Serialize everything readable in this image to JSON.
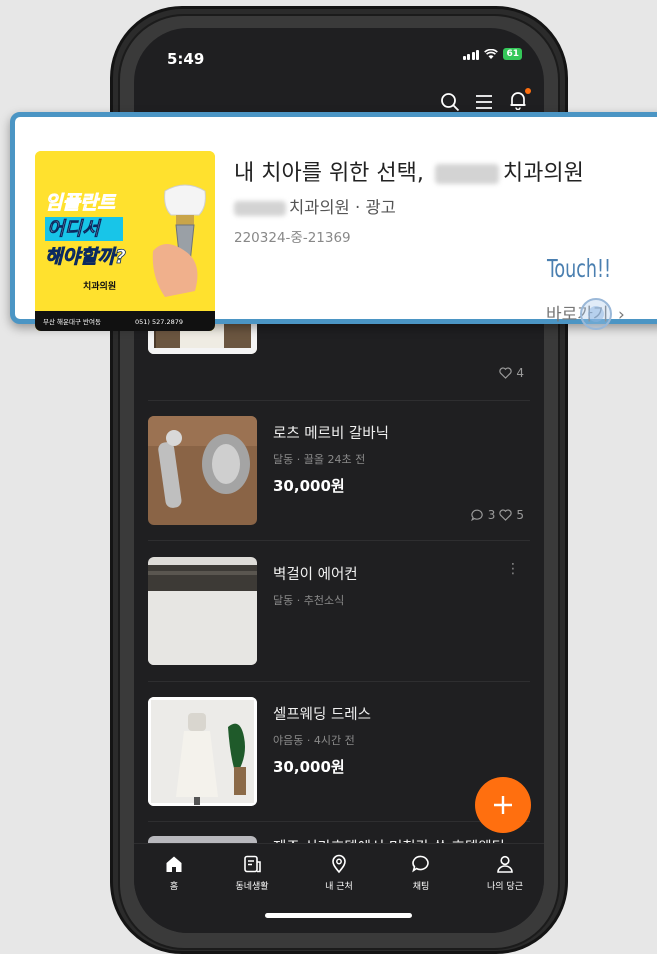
{
  "status": {
    "time": "5:49",
    "battery": "61"
  },
  "ad": {
    "title_prefix": "내 치아를 위한 선택,",
    "title_suffix": "치과의원",
    "sub_name": "치과의원",
    "sub_suffix": " · 광고",
    "code": "220324-중-21369",
    "go_label": "바로가기",
    "touch_label": "Touch!!",
    "image": {
      "line1": "임플란트",
      "line2": "어디서",
      "line3": "해야할까?",
      "clinic": "치과의원",
      "footer_loc": "부산 해운대구 반여동",
      "footer_tel": "051) 527.2879"
    }
  },
  "listings": [
    {
      "likes": "4"
    },
    {
      "title": "로츠 메르비 갈바닉",
      "meta": "달동 · 끌올 24초 전",
      "price": "30,000원",
      "comments": "3",
      "likes": "5"
    },
    {
      "title": "벽걸이 에어컨",
      "meta": "달동 · 추천소식"
    },
    {
      "title": "셀프웨딩 드레스",
      "meta": "야음동 · 4시간 전",
      "price": "30,000원"
    },
    {
      "title": "제주 신라호텔에서 며칠간 쓴 호텔웨딩..."
    }
  ],
  "nav": {
    "items": [
      {
        "label": "홈"
      },
      {
        "label": "동네생활"
      },
      {
        "label": "내 근처"
      },
      {
        "label": "채팅"
      },
      {
        "label": "나의 당근"
      }
    ]
  },
  "colors": {
    "accent": "#ff6f0f",
    "card_border": "#4b95c4",
    "background": "#1f1f21"
  }
}
